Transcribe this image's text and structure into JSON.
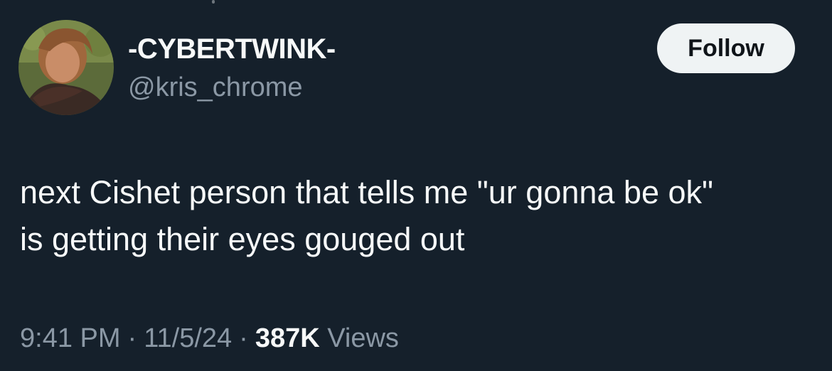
{
  "author": {
    "display_name": "-CYBERTWINK-",
    "handle": "@kris_chrome",
    "avatar_icon": "profile-photo"
  },
  "follow_button": {
    "label": "Follow"
  },
  "tweet": {
    "text_lines": [
      "next Cishet person that tells me \"ur gonna be ok\"",
      "is getting their eyes gouged out"
    ]
  },
  "meta": {
    "time": "9:41 PM",
    "separator": "·",
    "date": "11/5/24",
    "views_count": "387K",
    "views_label": "Views"
  },
  "colors": {
    "background": "#15202b",
    "primary_text": "#f7f9f9",
    "secondary_text": "#8b98a5",
    "follow_bg": "#eff3f4"
  }
}
